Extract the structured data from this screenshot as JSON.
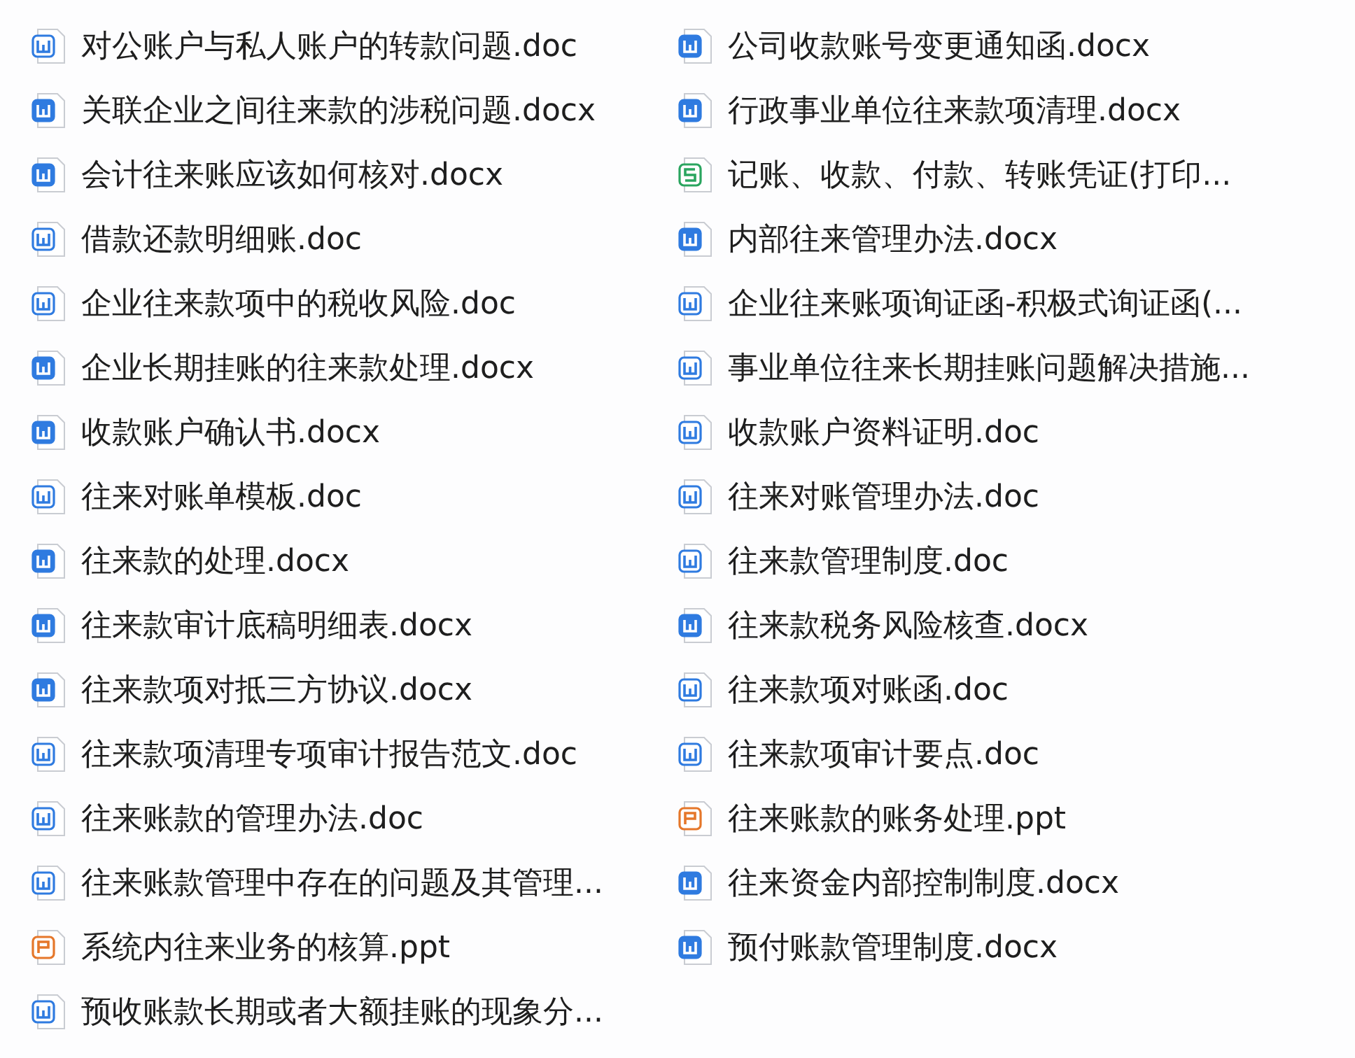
{
  "files": [
    {
      "name": "对公账户与私人账户的转款问题.doc",
      "kind": "doc"
    },
    {
      "name": "公司收款账号变更通知函.docx",
      "kind": "docx"
    },
    {
      "name": "关联企业之间往来款的涉税问题.docx",
      "kind": "docx"
    },
    {
      "name": "行政事业单位往来款项清理.docx",
      "kind": "docx"
    },
    {
      "name": "会计往来账应该如何核对.docx",
      "kind": "docx"
    },
    {
      "name": "记账、收款、付款、转账凭证(打印...",
      "kind": "sheet"
    },
    {
      "name": "借款还款明细账.doc",
      "kind": "doc"
    },
    {
      "name": "内部往来管理办法.docx",
      "kind": "docx"
    },
    {
      "name": "企业往来款项中的税收风险.doc",
      "kind": "doc"
    },
    {
      "name": "企业往来账项询证函-积极式询证函(...",
      "kind": "doc"
    },
    {
      "name": "企业长期挂账的往来款处理.docx",
      "kind": "docx"
    },
    {
      "name": "事业单位往来长期挂账问题解决措施...",
      "kind": "doc"
    },
    {
      "name": "收款账户确认书.docx",
      "kind": "docx"
    },
    {
      "name": "收款账户资料证明.doc",
      "kind": "doc"
    },
    {
      "name": "往来对账单模板.doc",
      "kind": "doc"
    },
    {
      "name": "往来对账管理办法.doc",
      "kind": "doc"
    },
    {
      "name": "往来款的处理.docx",
      "kind": "docx"
    },
    {
      "name": "往来款管理制度.doc",
      "kind": "doc"
    },
    {
      "name": "往来款审计底稿明细表.docx",
      "kind": "docx"
    },
    {
      "name": "往来款税务风险核查.docx",
      "kind": "docx"
    },
    {
      "name": "往来款项对抵三方协议.docx",
      "kind": "docx"
    },
    {
      "name": "往来款项对账函.doc",
      "kind": "doc"
    },
    {
      "name": "往来款项清理专项审计报告范文.doc",
      "kind": "doc"
    },
    {
      "name": "往来款项审计要点.doc",
      "kind": "doc"
    },
    {
      "name": "往来账款的管理办法.doc",
      "kind": "doc"
    },
    {
      "name": "往来账款的账务处理.ppt",
      "kind": "ppt"
    },
    {
      "name": "往来账款管理中存在的问题及其管理...",
      "kind": "doc"
    },
    {
      "name": "往来资金内部控制制度.docx",
      "kind": "docx"
    },
    {
      "name": "系统内往来业务的核算.ppt",
      "kind": "ppt"
    },
    {
      "name": "预付账款管理制度.docx",
      "kind": "docx"
    },
    {
      "name": "预收账款长期或者大额挂账的现象分...",
      "kind": "doc"
    }
  ]
}
